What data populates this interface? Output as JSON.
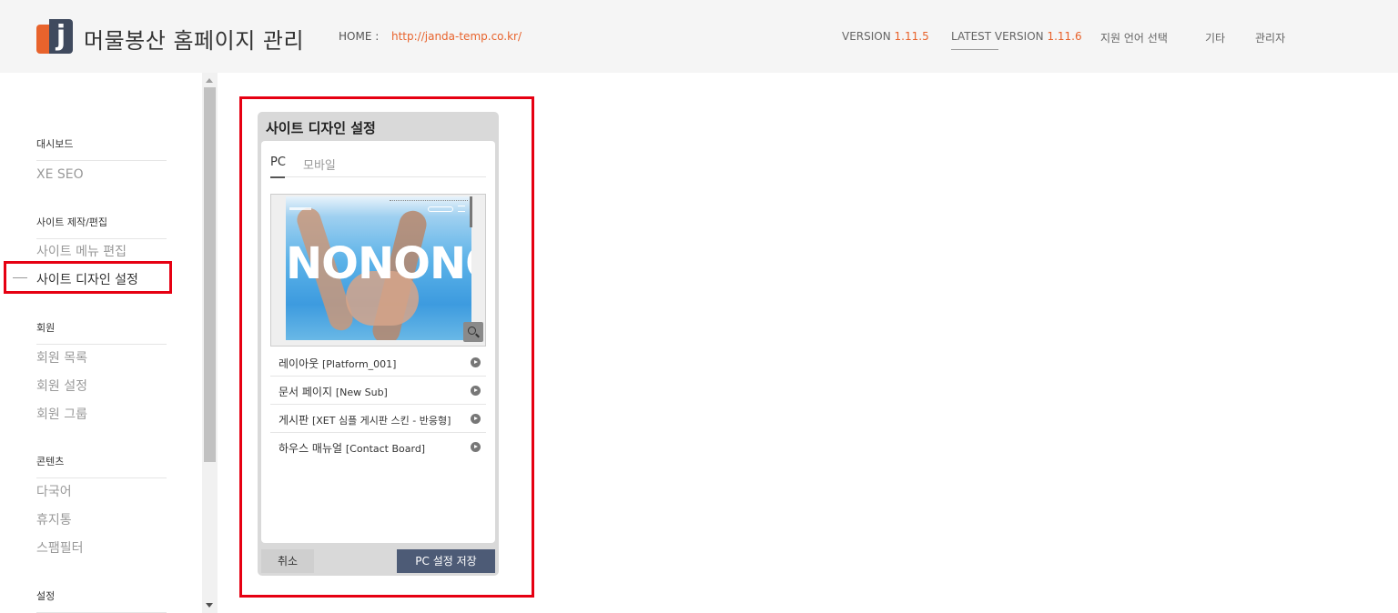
{
  "header": {
    "logo_letter": "j",
    "title": "머물봉산 홈페이지 관리",
    "home_label": "HOME :",
    "home_url": "http://janda-temp.co.kr/",
    "version_label": "VERSION",
    "version_value": "1.11.5",
    "latest_label": "LATEST VERSION",
    "latest_value": "1.11.6",
    "language": "지원 언어 선택",
    "etc": "기타",
    "admin": "관리자",
    "accent_color": "#e8632c"
  },
  "sidebar": {
    "groups": [
      {
        "title": "대시보드",
        "items": [
          "XE SEO"
        ]
      },
      {
        "title": "사이트 제작/편집",
        "items": [
          "사이트 메뉴 편집",
          "사이트 디자인 설정"
        ]
      },
      {
        "title": "회원",
        "items": [
          "회원 목록",
          "회원 설정",
          "회원 그룹"
        ]
      },
      {
        "title": "콘텐츠",
        "items": [
          "다국어",
          "휴지통",
          "스팸필터"
        ]
      },
      {
        "title": "설정",
        "items": []
      }
    ],
    "active_item": "사이트 디자인 설정"
  },
  "panel": {
    "title": "사이트 디자인 설정",
    "tabs": [
      "PC",
      "모바일"
    ],
    "active_tab": "PC",
    "preview_text": "NONONO",
    "layouts": [
      {
        "name": "레이아웃",
        "skin": "[Platform_001]"
      },
      {
        "name": "문서 페이지",
        "skin": "[New Sub]"
      },
      {
        "name": "게시판",
        "skin": "[XET 심플 게시판 스킨 - 반응형]"
      },
      {
        "name": "하우스 매뉴얼",
        "skin": "[Contact Board]"
      }
    ],
    "cancel_label": "취소",
    "save_label": "PC 설정 저장",
    "save_color": "#4d5b76"
  },
  "highlight_color": "#e60012"
}
